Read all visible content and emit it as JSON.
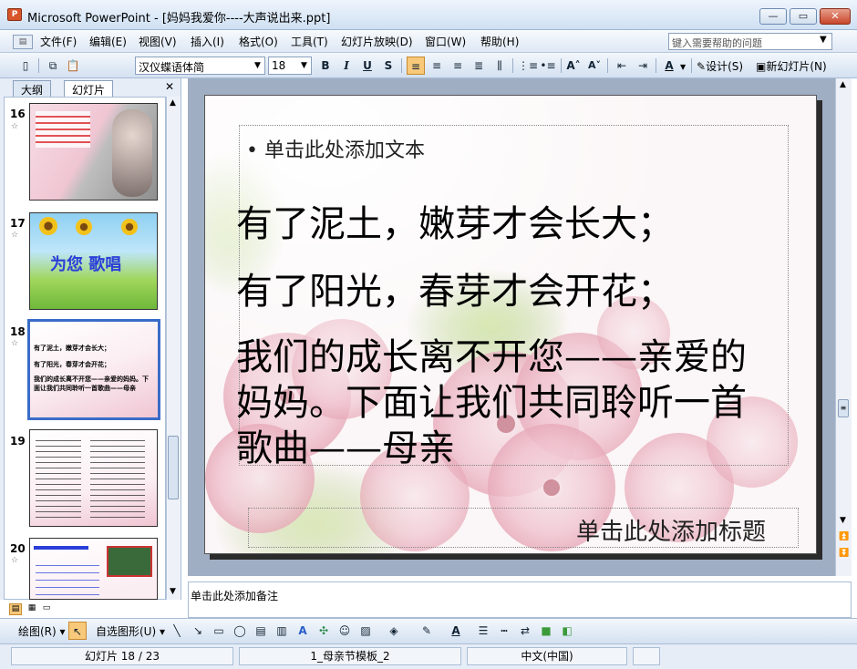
{
  "window": {
    "title": "Microsoft PowerPoint - [妈妈我爱你----大声说出来.ppt]",
    "app_icon_text": "P"
  },
  "menubar": {
    "items": [
      "文件(F)",
      "编辑(E)",
      "视图(V)",
      "插入(I)",
      "格式(O)",
      "工具(T)",
      "幻灯片放映(D)",
      "窗口(W)",
      "帮助(H)"
    ],
    "help_placeholder": "键入需要帮助的问题"
  },
  "toolbar": {
    "font_name": "汉仪蝶语体简",
    "font_size": "18",
    "bold": "B",
    "italic": "I",
    "underline": "U",
    "shadow": "S",
    "design_label": "设计(S)",
    "new_slide_label": "新幻灯片(N)"
  },
  "left_pane": {
    "tabs": [
      "大纲",
      "幻灯片"
    ],
    "selected_tab": "幻灯片",
    "thumbnails": [
      {
        "number": "16",
        "selected": false
      },
      {
        "number": "17",
        "selected": false,
        "text": "为您 歌唱"
      },
      {
        "number": "18",
        "selected": true,
        "lines": [
          "有了泥土，嫩芽才会长大；",
          "有了阳光，春芽才会开花；",
          "我们的成长离不开您——亲爱的妈妈。下面让我们共同聆听一首歌曲——母亲"
        ]
      },
      {
        "number": "19",
        "selected": false
      },
      {
        "number": "20",
        "selected": false
      }
    ]
  },
  "slide": {
    "body_placeholder": "单击此处添加文本",
    "lines": [
      "有了泥土，嫩芽才会长大；",
      "有了阳光，春芽才会开花；",
      "我们的成长离不开您——亲爱的",
      "妈妈。下面让我们共同聆听一首",
      "歌曲——母亲"
    ],
    "title_placeholder": "单击此处添加标题"
  },
  "notes": {
    "placeholder": "单击此处添加备注"
  },
  "drawbar": {
    "draw_label": "绘图(R)",
    "autoshapes_label": "自选图形(U)"
  },
  "status": {
    "slide_position": "幻灯片 18 / 23",
    "template": "1_母亲节模板_2",
    "language": "中文(中国)"
  },
  "colors": {
    "accent": "#d8552a",
    "chrome": "#d4e1f1",
    "selected_thumb_border": "#3a6cc8"
  }
}
